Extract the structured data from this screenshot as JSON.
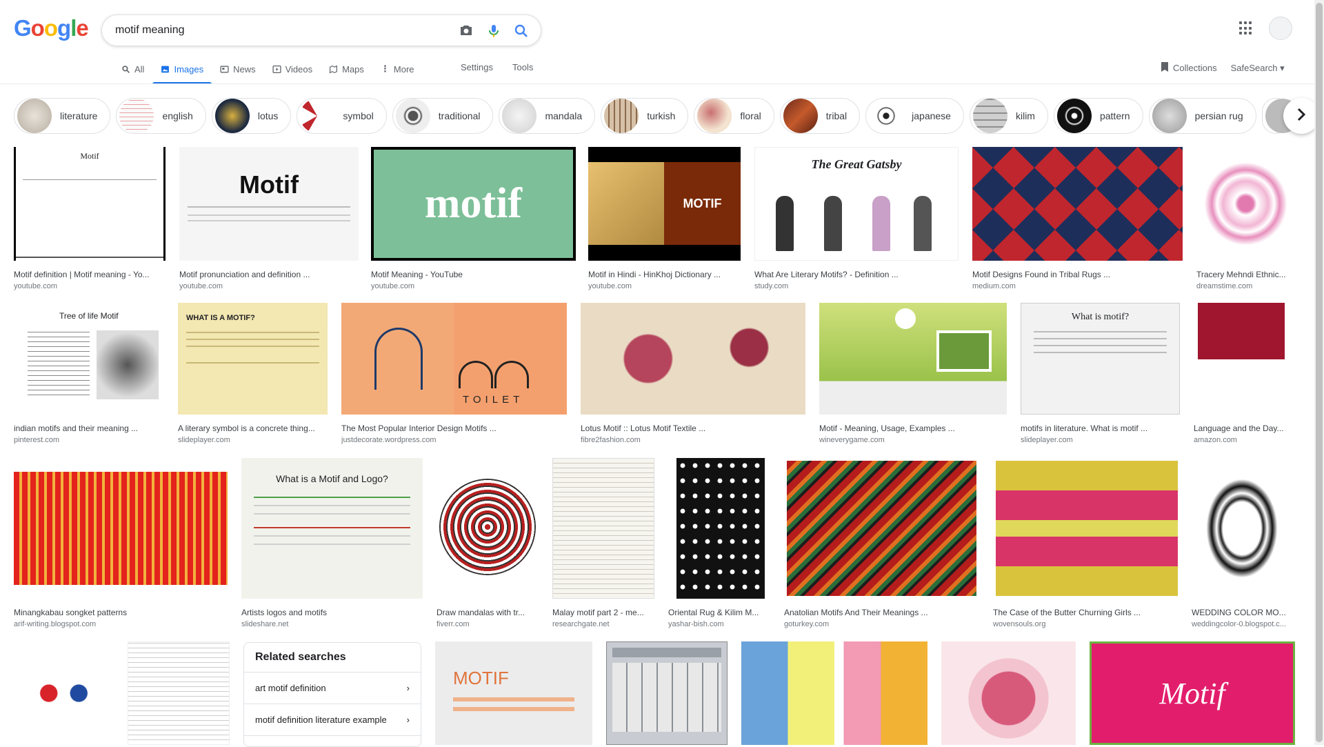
{
  "logo": "Google",
  "search": {
    "query": "motif meaning"
  },
  "tabs": [
    "All",
    "Images",
    "News",
    "Videos",
    "Maps",
    "More"
  ],
  "tools": [
    "Settings",
    "Tools"
  ],
  "right_tabs": [
    "Collections",
    "SafeSearch"
  ],
  "chips": [
    "literature",
    "english",
    "lotus",
    "symbol",
    "traditional",
    "mandala",
    "turkish",
    "floral",
    "tribal",
    "japanese",
    "kilim",
    "pattern",
    "persian rug"
  ],
  "results": [
    {
      "title": "Motif definition | Motif meaning - Yo...",
      "source": "youtube.com",
      "img_text": "Motif"
    },
    {
      "title": "Motif pronunciation and definition ...",
      "source": "youtube.com",
      "img_text": "Motif"
    },
    {
      "title": "Motif Meaning - YouTube",
      "source": "youtube.com",
      "img_text": "motif"
    },
    {
      "title": "Motif in Hindi - HinKhoj Dictionary ...",
      "source": "youtube.com",
      "img_text": "MOTIF"
    },
    {
      "title": "What Are Literary Motifs? - Definition ...",
      "source": "study.com",
      "img_text": "The Great Gatsby"
    },
    {
      "title": "Motif Designs Found in Tribal Rugs ...",
      "source": "medium.com",
      "img_text": ""
    },
    {
      "title": "Tracery Mehndi Ethnic...",
      "source": "dreamstime.com",
      "img_text": ""
    },
    {
      "title": "indian motifs and their meaning ...",
      "source": "pinterest.com",
      "img_text": "Tree of life Motif"
    },
    {
      "title": "A literary symbol is a concrete thing...",
      "source": "slideplayer.com",
      "img_text": "WHAT IS A MOTIF?"
    },
    {
      "title": "The Most Popular Interior Design Motifs ...",
      "source": "justdecorate.wordpress.com",
      "img_text": "TOILET"
    },
    {
      "title": "Lotus Motif :: Lotus Motif Textile ...",
      "source": "fibre2fashion.com",
      "img_text": ""
    },
    {
      "title": "Motif - Meaning, Usage, Examples ...",
      "source": "wineverygame.com",
      "img_text": ""
    },
    {
      "title": "motifs in literature. What is motif ...",
      "source": "slideplayer.com",
      "img_text": "What is motif?"
    },
    {
      "title": "Language and the Day...",
      "source": "amazon.com",
      "img_text": ""
    },
    {
      "title": "Minangkabau songket patterns",
      "source": "arif-writing.blogspot.com",
      "img_text": ""
    },
    {
      "title": "Artists logos and motifs",
      "source": "slideshare.net",
      "img_text": "What is a Motif and Logo?"
    },
    {
      "title": "Draw mandalas with tr...",
      "source": "fiverr.com",
      "img_text": ""
    },
    {
      "title": "Malay motif part 2 - me...",
      "source": "researchgate.net",
      "img_text": ""
    },
    {
      "title": "Oriental Rug & Kilim M...",
      "source": "yashar-bish.com",
      "img_text": ""
    },
    {
      "title": "Anatolian Motifs And Their Meanings ...",
      "source": "goturkey.com",
      "img_text": ""
    },
    {
      "title": "The Case of the Butter Churning Girls ...",
      "source": "wovensouls.org",
      "img_text": ""
    },
    {
      "title": "WEDDING COLOR MO...",
      "source": "weddingcolor-0.blogspot.c...",
      "img_text": ""
    },
    {
      "title": "",
      "source": "",
      "img_text": "MOTIF"
    },
    {
      "title": "",
      "source": "",
      "img_text": "Motif"
    }
  ],
  "related": {
    "heading": "Related searches",
    "items": [
      "art motif definition",
      "motif definition literature example"
    ]
  }
}
